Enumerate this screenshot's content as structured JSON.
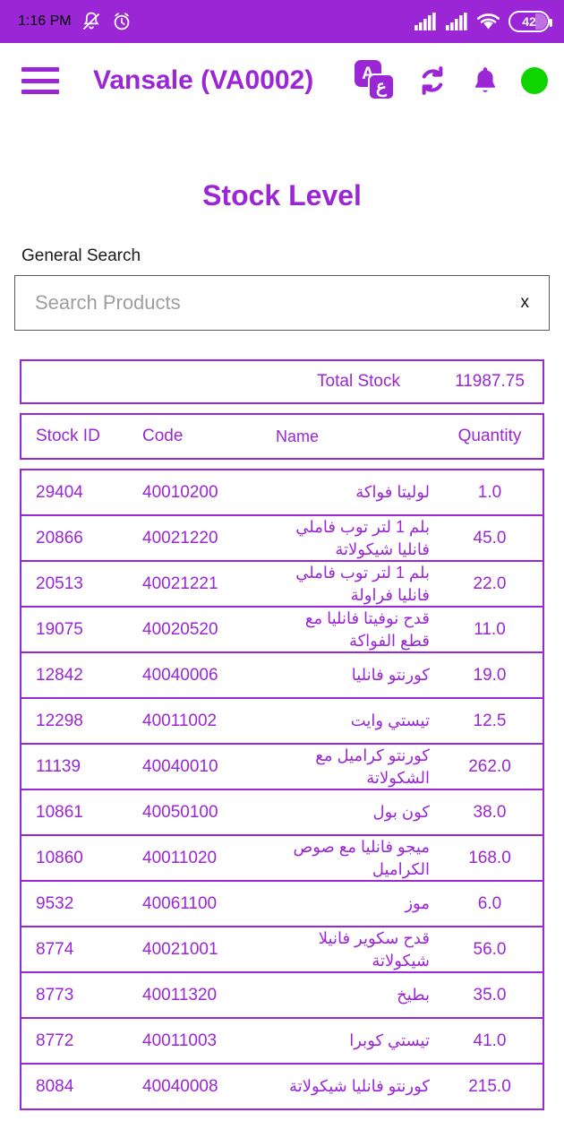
{
  "status_bar": {
    "time": "1:16 PM",
    "icons": [
      "bell-muted-icon",
      "alarm-clock-icon",
      "signal-bars-icon",
      "signal-bars-icon",
      "wifi-icon"
    ],
    "battery_level": "42",
    "background_color": "#9B26D6"
  },
  "app_bar": {
    "menu_icon": "hamburger-menu-icon",
    "title": "Vansale (VA0002)",
    "language_icon": {
      "latin": "A",
      "arabic": "ع"
    },
    "refresh_icon": "refresh-sync-icon",
    "notification_icon": "bell-icon",
    "status_dot_color": "#0ED500",
    "accent_color": "#9B26D6"
  },
  "page": {
    "title": "Stock Level"
  },
  "search": {
    "label": "General Search",
    "value": "",
    "placeholder": "Search Products",
    "clear_label": "x"
  },
  "summary": {
    "total_label": "Total Stock",
    "total_value": "11987.75"
  },
  "table": {
    "columns": [
      "Stock ID",
      "Code",
      "Name",
      "Quantity"
    ],
    "rows": [
      {
        "stock_id": "29404",
        "code": "40010200",
        "name": "لوليتا فواكة",
        "quantity": "1.0"
      },
      {
        "stock_id": "20866",
        "code": "40021220",
        "name": "بلم 1 لتر توب فاملي فانليا شيكولاتة",
        "quantity": "45.0"
      },
      {
        "stock_id": "20513",
        "code": "40021221",
        "name": "بلم 1 لتر توب فاملي فانليا فراولة",
        "quantity": "22.0"
      },
      {
        "stock_id": "19075",
        "code": "40020520",
        "name": "قدح نوفيتا فانليا مع قطع الفواكة",
        "quantity": "11.0"
      },
      {
        "stock_id": "12842",
        "code": "40040006",
        "name": "كورنتو فانليا",
        "quantity": "19.0"
      },
      {
        "stock_id": "12298",
        "code": "40011002",
        "name": "تيستي وايت",
        "quantity": "12.5"
      },
      {
        "stock_id": "11139",
        "code": "40040010",
        "name": "كورنتو كراميل مع الشكولاتة",
        "quantity": "262.0"
      },
      {
        "stock_id": "10861",
        "code": "40050100",
        "name": "كون بول",
        "quantity": "38.0"
      },
      {
        "stock_id": "10860",
        "code": "40011020",
        "name": "ميجو فانليا مع صوص الكراميل",
        "quantity": "168.0"
      },
      {
        "stock_id": "9532",
        "code": "40061100",
        "name": "موز",
        "quantity": "6.0"
      },
      {
        "stock_id": "8774",
        "code": "40021001",
        "name": "قدح سكوير فانيلا شيكولاتة",
        "quantity": "56.0"
      },
      {
        "stock_id": "8773",
        "code": "40011320",
        "name": "بطيخ",
        "quantity": "35.0"
      },
      {
        "stock_id": "8772",
        "code": "40011003",
        "name": "تيستي كوبرا",
        "quantity": "41.0"
      },
      {
        "stock_id": "8084",
        "code": "40040008",
        "name": "كورنتو فانليا شيكولاتة",
        "quantity": "215.0"
      }
    ]
  }
}
